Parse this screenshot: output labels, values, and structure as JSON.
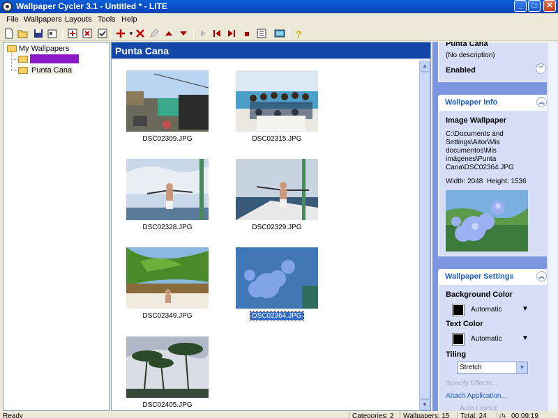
{
  "window": {
    "title": "Wallpaper Cycler 3.1 - Untitled * - LITE",
    "minimize": "_",
    "maximize": "□",
    "close": "✕"
  },
  "menu": [
    "File",
    "Wallpapers",
    "Layouts",
    "Tools",
    "Help"
  ],
  "toolbar": {
    "icons": [
      "new-icon",
      "open-icon",
      "save-icon",
      "properties-icon",
      "add-category-icon",
      "remove-category-icon",
      "check-icon",
      "add-icon",
      "delete-icon",
      "edit-icon",
      "move-up-icon",
      "move-down-icon",
      "play-icon",
      "first-icon",
      "next-icon",
      "stop-icon",
      "options-icon",
      "screen-icon",
      "help-icon"
    ],
    "add_dropdown": "▾"
  },
  "tree": {
    "root": "My Wallpapers",
    "items": [
      {
        "label": "",
        "selected": true
      },
      {
        "label": "Punta Cana",
        "selected": false
      }
    ],
    "selected_color": "#8c19c8"
  },
  "content": {
    "header": "Punta Cana",
    "thumbnails": [
      {
        "name": "DSC02309.JPG",
        "selected": false
      },
      {
        "name": "DSC02315.JPG",
        "selected": false
      },
      {
        "name": "DSC02328.JPG",
        "selected": false
      },
      {
        "name": "DSC02329.JPG",
        "selected": false
      },
      {
        "name": "DSC02349.JPG",
        "selected": false
      },
      {
        "name": "DSC02364.JPG",
        "selected": true
      },
      {
        "name": "DSC02405.JPG",
        "selected": false
      }
    ]
  },
  "taskpane": {
    "category": {
      "name": "Punta Cana",
      "description": "(No description)",
      "status": "Enabled"
    },
    "info": {
      "title": "Wallpaper Info",
      "type": "Image Wallpaper",
      "path_lines": [
        "C:\\Documents and",
        "Settings\\Aitor\\Mis",
        "documentos\\Mis",
        "imágenes\\Punta",
        "Cana\\DSC02364.JPG"
      ],
      "dimensions": "Width: 2048  Height: 1536"
    },
    "settings": {
      "title": "Wallpaper Settings",
      "bg_color_label": "Background Color",
      "bg_color_value": "Automatic",
      "text_color_label": "Text Color",
      "text_color_value": "Automatic",
      "tiling_label": "Tiling",
      "tiling_value": "Stretch",
      "specify_effects": "Specify Effects...",
      "attach_application": "Attach Application...",
      "auto_layout": "Auto Layout"
    }
  },
  "status": {
    "ready": "Ready",
    "categories": "Categories: 2",
    "wallpapers": "Wallpapers: 15",
    "total": "Total: 24",
    "time": "00:09:19"
  }
}
